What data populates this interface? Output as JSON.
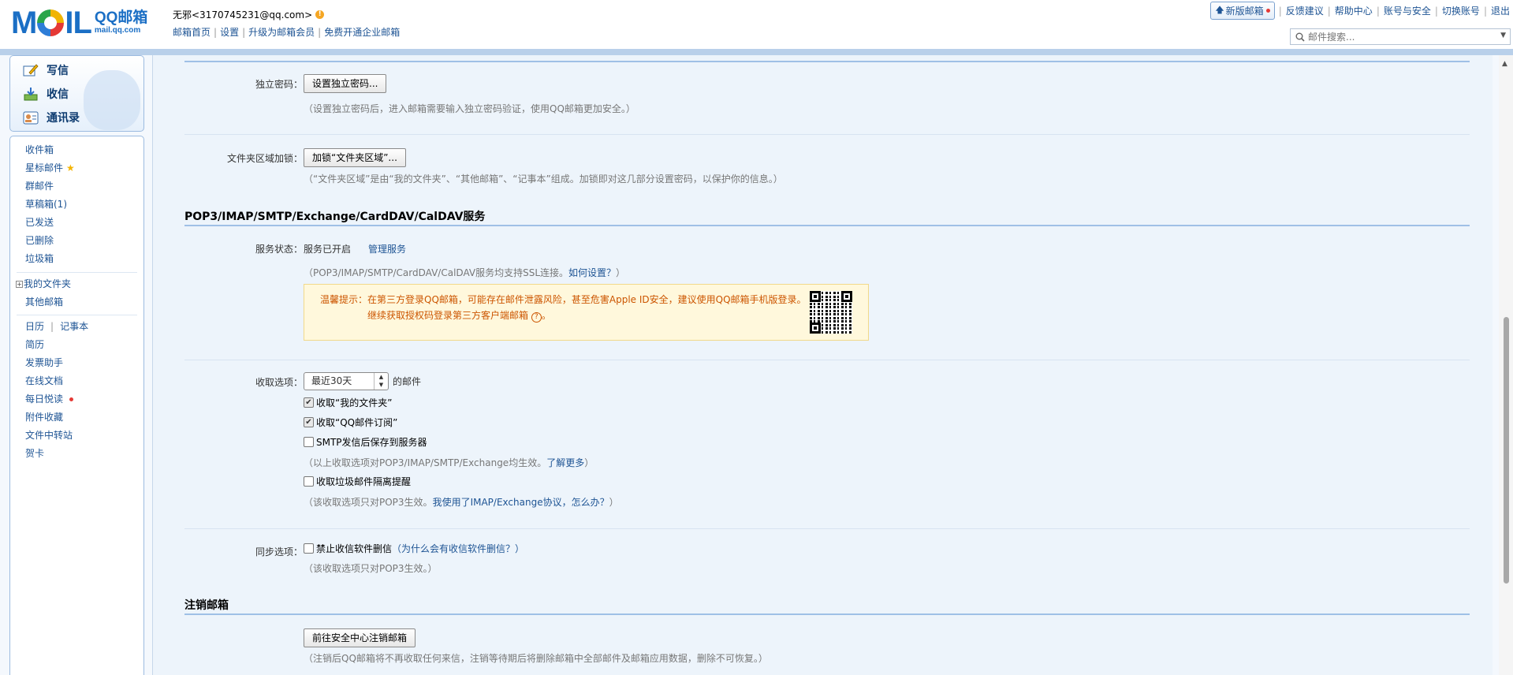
{
  "header": {
    "logo_text": "MOIL",
    "logo_brand": "QQ邮箱",
    "logo_url": "mail.qq.com",
    "user_name": "无邪<3170745231@qq.com>",
    "links": [
      "邮箱首页",
      "设置",
      "升级为邮箱会员",
      "免费开通企业邮箱"
    ],
    "top_links": {
      "new_version": "新版邮箱",
      "feedback": "反馈建议",
      "help": "帮助中心",
      "account_security": "账号与安全",
      "switch_account": "切换账号",
      "logout": "退出"
    },
    "search_placeholder": "邮件搜索..."
  },
  "sidebar": {
    "actions": [
      "写信",
      "收信",
      "通讯录"
    ],
    "folders": [
      "收件箱",
      "星标邮件",
      "群邮件",
      "草稿箱(1)",
      "已发送",
      "已删除",
      "垃圾箱"
    ],
    "my_folders": "我的文件夹",
    "other_mail": "其他邮箱",
    "calendar": "日历",
    "notepad": "记事本",
    "apps": [
      "简历",
      "发票助手",
      "在线文档",
      "每日悦读",
      "附件收藏",
      "文件中转站",
      "贺卡"
    ]
  },
  "settings": {
    "independent_password": {
      "label": "独立密码：",
      "button": "设置独立密码...",
      "hint": "（设置独立密码后，进入邮箱需要输入独立密码验证，使用QQ邮箱更加安全。）"
    },
    "folder_lock": {
      "label": "文件夹区域加锁：",
      "button": "加锁“文件夹区域”...",
      "hint": "（“文件夹区域”是由“我的文件夹”、“其他邮箱”、“记事本”组成。加锁即对这几部分设置密码，以保护你的信息。）"
    },
    "protocol_section": {
      "title": "POP3/IMAP/SMTP/Exchange/CardDAV/CalDAV服务",
      "status_label": "服务状态：",
      "status_value": "服务已开启",
      "manage_link": "管理服务",
      "ssl_hint": "（POP3/IMAP/SMTP/CardDAV/CalDAV服务均支持SSL连接。",
      "ssl_link": "如何设置？",
      "ssl_hint_end": "）",
      "warning_prefix": "温馨提示：",
      "warning_line1": "在第三方登录QQ邮箱，可能存在邮件泄露风险，甚至危害Apple ID安全，建议使用QQ邮箱手机版登录。",
      "warning_line2": "继续获取授权码登录第三方客户端邮箱",
      "warning_q": "?"
    },
    "receive": {
      "label": "收取选项：",
      "range": "最近30天",
      "suffix": "的邮件",
      "options": [
        {
          "text": "收取“我的文件夹”",
          "checked": true
        },
        {
          "text": "收取“QQ邮件订阅”",
          "checked": true
        },
        {
          "text": "SMTP发信后保存到服务器",
          "checked": false
        }
      ],
      "hint1": "（以上收取选项对POP3/IMAP/SMTP/Exchange均生效。",
      "hint1_link": "了解更多",
      "hint1_end": "）",
      "spam_option": "收取垃圾邮件隔离提醒",
      "hint2": "（该收取选项只对POP3生效。",
      "hint2_link": "我使用了IMAP/Exchange协议，怎么办？",
      "hint2_end": "）"
    },
    "sync": {
      "label": "同步选项：",
      "option": "禁止收信软件删信",
      "why_link": "（为什么会有收信软件删信？）",
      "hint": "（该收取选项只对POP3生效。）"
    },
    "cancel": {
      "title": "注销邮箱",
      "button": "前往安全中心注销邮箱",
      "hint": "（注销后QQ邮箱将不再收取任何来信，注销等待期后将删除邮箱中全部邮件及邮箱应用数据，删除不可恢复。）"
    }
  }
}
